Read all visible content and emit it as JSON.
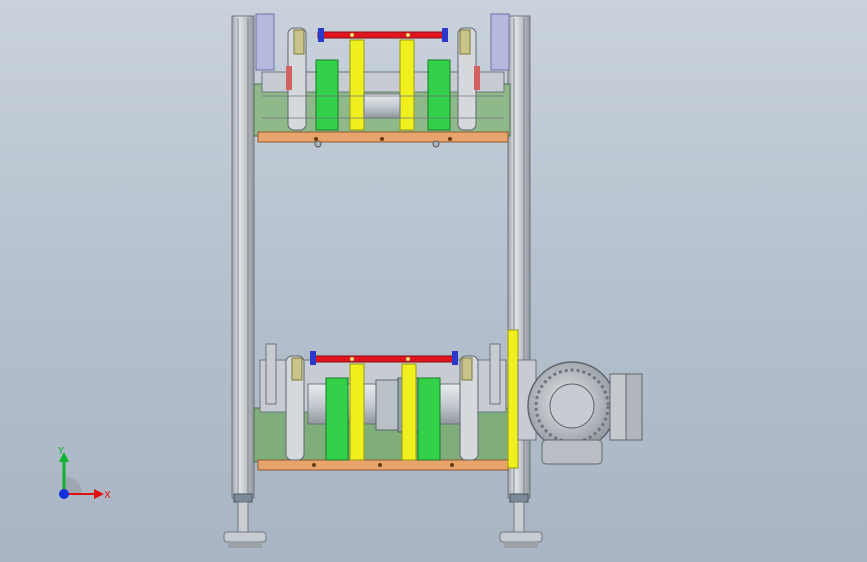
{
  "viewport": {
    "background_top": "#c9d2dc",
    "background_bottom": "#a9b5c3"
  },
  "colors": {
    "frame_aluminium": "#d4d8dc",
    "frame_shadow": "#8e959c",
    "plate_orange": "#e8a46a",
    "plate_green": "#7fae7a",
    "block_green": "#33d04a",
    "support_yellow": "#f0f01e",
    "rod_red": "#e0161e",
    "clamp_blue": "#2a39c9",
    "motor_grey": "#b9bec4",
    "wheel_olive": "#c8c48a"
  },
  "triad": {
    "x_label": "X",
    "y_label": "Y",
    "x_color": "#e01010",
    "y_color": "#10b030",
    "z_color": "#1030e0",
    "icon": "coordinate-triad-icon"
  }
}
